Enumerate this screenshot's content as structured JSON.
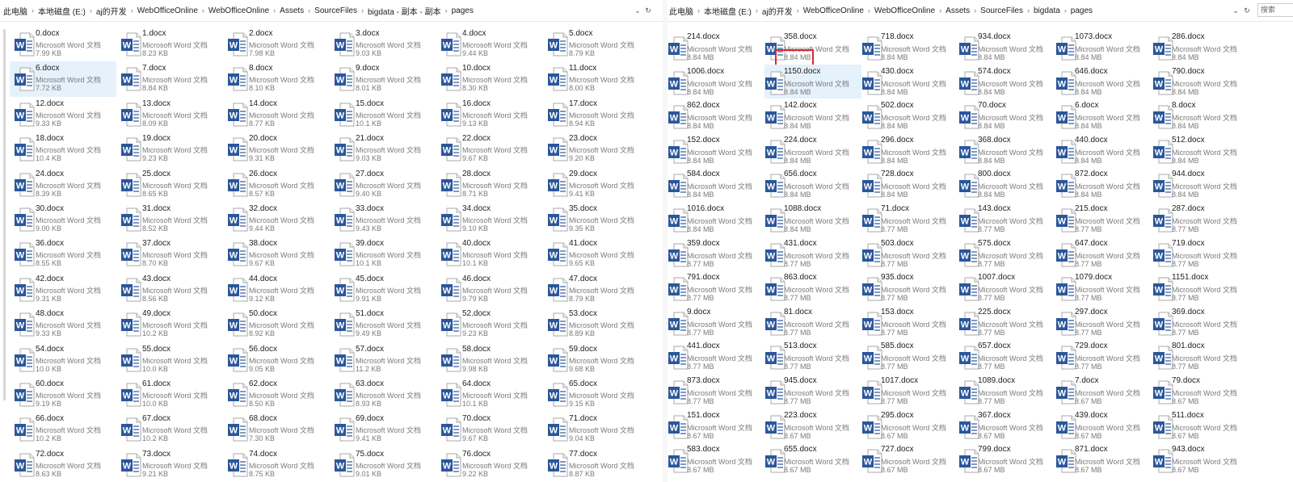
{
  "left_window": {
    "breadcrumb": [
      "此电脑",
      "本地磁盘 (E:)",
      "aj的开发",
      "WebOfficeOnline",
      "WebOfficeOnline",
      "Assets",
      "SourceFiles",
      "bigdata - 副本 - 副本",
      "pages"
    ],
    "files": [
      {
        "name": "0.docx",
        "type": "Microsoft Word 文档",
        "size": "7.99 KB"
      },
      {
        "name": "1.docx",
        "type": "Microsoft Word 文档",
        "size": "8.23 KB"
      },
      {
        "name": "2.docx",
        "type": "Microsoft Word 文档",
        "size": "7.98 KB"
      },
      {
        "name": "3.docx",
        "type": "Microsoft Word 文档",
        "size": "9.03 KB"
      },
      {
        "name": "4.docx",
        "type": "Microsoft Word 文档",
        "size": "9.44 KB"
      },
      {
        "name": "5.docx",
        "type": "Microsoft Word 文档",
        "size": "8.79 KB"
      },
      {
        "name": "6.docx",
        "type": "Microsoft Word 文档",
        "size": "7.72 KB",
        "selected": true
      },
      {
        "name": "7.docx",
        "type": "Microsoft Word 文档",
        "size": "8.84 KB"
      },
      {
        "name": "8.docx",
        "type": "Microsoft Word 文档",
        "size": "8.10 KB"
      },
      {
        "name": "9.docx",
        "type": "Microsoft Word 文档",
        "size": "8.01 KB"
      },
      {
        "name": "10.docx",
        "type": "Microsoft Word 文档",
        "size": "8.30 KB"
      },
      {
        "name": "11.docx",
        "type": "Microsoft Word 文档",
        "size": "8.00 KB"
      },
      {
        "name": "12.docx",
        "type": "Microsoft Word 文档",
        "size": "9.33 KB"
      },
      {
        "name": "13.docx",
        "type": "Microsoft Word 文档",
        "size": "8.09 KB"
      },
      {
        "name": "14.docx",
        "type": "Microsoft Word 文档",
        "size": "8.77 KB"
      },
      {
        "name": "15.docx",
        "type": "Microsoft Word 文档",
        "size": "10.1 KB"
      },
      {
        "name": "16.docx",
        "type": "Microsoft Word 文档",
        "size": "9.13 KB"
      },
      {
        "name": "17.docx",
        "type": "Microsoft Word 文档",
        "size": "8.94 KB"
      },
      {
        "name": "18.docx",
        "type": "Microsoft Word 文档",
        "size": "10.4 KB"
      },
      {
        "name": "19.docx",
        "type": "Microsoft Word 文档",
        "size": "9.23 KB"
      },
      {
        "name": "20.docx",
        "type": "Microsoft Word 文档",
        "size": "9.31 KB"
      },
      {
        "name": "21.docx",
        "type": "Microsoft Word 文档",
        "size": "9.03 KB"
      },
      {
        "name": "22.docx",
        "type": "Microsoft Word 文档",
        "size": "9.67 KB"
      },
      {
        "name": "23.docx",
        "type": "Microsoft Word 文档",
        "size": "9.20 KB"
      },
      {
        "name": "24.docx",
        "type": "Microsoft Word 文档",
        "size": "8.39 KB"
      },
      {
        "name": "25.docx",
        "type": "Microsoft Word 文档",
        "size": "8.65 KB"
      },
      {
        "name": "26.docx",
        "type": "Microsoft Word 文档",
        "size": "8.57 KB"
      },
      {
        "name": "27.docx",
        "type": "Microsoft Word 文档",
        "size": "9.40 KB"
      },
      {
        "name": "28.docx",
        "type": "Microsoft Word 文档",
        "size": "8.71 KB"
      },
      {
        "name": "29.docx",
        "type": "Microsoft Word 文档",
        "size": "9.41 KB"
      },
      {
        "name": "30.docx",
        "type": "Microsoft Word 文档",
        "size": "9.00 KB"
      },
      {
        "name": "31.docx",
        "type": "Microsoft Word 文档",
        "size": "8.52 KB"
      },
      {
        "name": "32.docx",
        "type": "Microsoft Word 文档",
        "size": "9.44 KB"
      },
      {
        "name": "33.docx",
        "type": "Microsoft Word 文档",
        "size": "9.43 KB"
      },
      {
        "name": "34.docx",
        "type": "Microsoft Word 文档",
        "size": "9.10 KB"
      },
      {
        "name": "35.docx",
        "type": "Microsoft Word 文档",
        "size": "9.35 KB"
      },
      {
        "name": "36.docx",
        "type": "Microsoft Word 文档",
        "size": "8.55 KB"
      },
      {
        "name": "37.docx",
        "type": "Microsoft Word 文档",
        "size": "8.70 KB"
      },
      {
        "name": "38.docx",
        "type": "Microsoft Word 文档",
        "size": "9.67 KB"
      },
      {
        "name": "39.docx",
        "type": "Microsoft Word 文档",
        "size": "10.1 KB"
      },
      {
        "name": "40.docx",
        "type": "Microsoft Word 文档",
        "size": "10.1 KB"
      },
      {
        "name": "41.docx",
        "type": "Microsoft Word 文档",
        "size": "9.65 KB"
      },
      {
        "name": "42.docx",
        "type": "Microsoft Word 文档",
        "size": "9.31 KB"
      },
      {
        "name": "43.docx",
        "type": "Microsoft Word 文档",
        "size": "8.56 KB"
      },
      {
        "name": "44.docx",
        "type": "Microsoft Word 文档",
        "size": "9.12 KB"
      },
      {
        "name": "45.docx",
        "type": "Microsoft Word 文档",
        "size": "9.91 KB"
      },
      {
        "name": "46.docx",
        "type": "Microsoft Word 文档",
        "size": "9.79 KB"
      },
      {
        "name": "47.docx",
        "type": "Microsoft Word 文档",
        "size": "8.79 KB"
      },
      {
        "name": "48.docx",
        "type": "Microsoft Word 文档",
        "size": "9.33 KB"
      },
      {
        "name": "49.docx",
        "type": "Microsoft Word 文档",
        "size": "10.2 KB"
      },
      {
        "name": "50.docx",
        "type": "Microsoft Word 文档",
        "size": "8.92 KB"
      },
      {
        "name": "51.docx",
        "type": "Microsoft Word 文档",
        "size": "9.49 KB"
      },
      {
        "name": "52.docx",
        "type": "Microsoft Word 文档",
        "size": "9.23 KB"
      },
      {
        "name": "53.docx",
        "type": "Microsoft Word 文档",
        "size": "8.89 KB"
      },
      {
        "name": "54.docx",
        "type": "Microsoft Word 文档",
        "size": "10.0 KB"
      },
      {
        "name": "55.docx",
        "type": "Microsoft Word 文档",
        "size": "10.0 KB"
      },
      {
        "name": "56.docx",
        "type": "Microsoft Word 文档",
        "size": "9.05 KB"
      },
      {
        "name": "57.docx",
        "type": "Microsoft Word 文档",
        "size": "11.2 KB"
      },
      {
        "name": "58.docx",
        "type": "Microsoft Word 文档",
        "size": "9.98 KB"
      },
      {
        "name": "59.docx",
        "type": "Microsoft Word 文档",
        "size": "9.68 KB"
      },
      {
        "name": "60.docx",
        "type": "Microsoft Word 文档",
        "size": "9.19 KB"
      },
      {
        "name": "61.docx",
        "type": "Microsoft Word 文档",
        "size": "10.0 KB"
      },
      {
        "name": "62.docx",
        "type": "Microsoft Word 文档",
        "size": "8.50 KB"
      },
      {
        "name": "63.docx",
        "type": "Microsoft Word 文档",
        "size": "8.93 KB"
      },
      {
        "name": "64.docx",
        "type": "Microsoft Word 文档",
        "size": "10.1 KB"
      },
      {
        "name": "65.docx",
        "type": "Microsoft Word 文档",
        "size": "9.15 KB"
      },
      {
        "name": "66.docx",
        "type": "Microsoft Word 文档",
        "size": "10.2 KB"
      },
      {
        "name": "67.docx",
        "type": "Microsoft Word 文档",
        "size": "10.2 KB"
      },
      {
        "name": "68.docx",
        "type": "Microsoft Word 文档",
        "size": "7.30 KB"
      },
      {
        "name": "69.docx",
        "type": "Microsoft Word 文档",
        "size": "9.41 KB"
      },
      {
        "name": "70.docx",
        "type": "Microsoft Word 文档",
        "size": "9.67 KB"
      },
      {
        "name": "71.docx",
        "type": "Microsoft Word 文档",
        "size": "9.04 KB"
      },
      {
        "name": "72.docx",
        "type": "Microsoft Word 文档",
        "size": "8.63 KB"
      },
      {
        "name": "73.docx",
        "type": "Microsoft Word 文档",
        "size": "9.21 KB"
      },
      {
        "name": "74.docx",
        "type": "Microsoft Word 文档",
        "size": "8.75 KB"
      },
      {
        "name": "75.docx",
        "type": "Microsoft Word 文档",
        "size": "9.01 KB"
      },
      {
        "name": "76.docx",
        "type": "Microsoft Word 文档",
        "size": "9.22 KB"
      },
      {
        "name": "77.docx",
        "type": "Microsoft Word 文档",
        "size": "8.87 KB"
      }
    ]
  },
  "right_window": {
    "breadcrumb": [
      "此电脑",
      "本地磁盘 (E:)",
      "aj的开发",
      "WebOfficeOnline",
      "WebOfficeOnline",
      "Assets",
      "SourceFiles",
      "bigdata",
      "pages"
    ],
    "search_placeholder": "搜索",
    "files": [
      {
        "name": "214.docx",
        "type": "Microsoft Word 文档",
        "size": "8.84 MB"
      },
      {
        "name": "358.docx",
        "type": "Microsoft Word 文档",
        "size": "8.84 MB",
        "highlighted": true
      },
      {
        "name": "718.docx",
        "type": "Microsoft Word 文档",
        "size": "8.84 MB"
      },
      {
        "name": "934.docx",
        "type": "Microsoft Word 文档",
        "size": "8.84 MB"
      },
      {
        "name": "1073.docx",
        "type": "Microsoft Word 文档",
        "size": "8.84 MB"
      },
      {
        "name": "286.docx",
        "type": "Microsoft Word 文档",
        "size": "8.84 MB"
      },
      {
        "name": "1006.docx",
        "type": "Microsoft Word 文档",
        "size": "8.84 MB"
      },
      {
        "name": "1150.docx",
        "type": "Microsoft Word 文档",
        "size": "8.84 MB",
        "selected": true
      },
      {
        "name": "430.docx",
        "type": "Microsoft Word 文档",
        "size": "8.84 MB"
      },
      {
        "name": "574.docx",
        "type": "Microsoft Word 文档",
        "size": "8.84 MB"
      },
      {
        "name": "646.docx",
        "type": "Microsoft Word 文档",
        "size": "8.84 MB"
      },
      {
        "name": "790.docx",
        "type": "Microsoft Word 文档",
        "size": "8.84 MB"
      },
      {
        "name": "862.docx",
        "type": "Microsoft Word 文档",
        "size": "8.84 MB"
      },
      {
        "name": "142.docx",
        "type": "Microsoft Word 文档",
        "size": "8.84 MB"
      },
      {
        "name": "502.docx",
        "type": "Microsoft Word 文档",
        "size": "8.84 MB"
      },
      {
        "name": "70.docx",
        "type": "Microsoft Word 文档",
        "size": "8.84 MB"
      },
      {
        "name": "6.docx",
        "type": "Microsoft Word 文档",
        "size": "8.84 MB"
      },
      {
        "name": "8.docx",
        "type": "Microsoft Word 文档",
        "size": "8.84 MB"
      },
      {
        "name": "152.docx",
        "type": "Microsoft Word 文档",
        "size": "8.84 MB"
      },
      {
        "name": "224.docx",
        "type": "Microsoft Word 文档",
        "size": "8.84 MB"
      },
      {
        "name": "296.docx",
        "type": "Microsoft Word 文档",
        "size": "8.84 MB"
      },
      {
        "name": "368.docx",
        "type": "Microsoft Word 文档",
        "size": "8.84 MB"
      },
      {
        "name": "440.docx",
        "type": "Microsoft Word 文档",
        "size": "8.84 MB"
      },
      {
        "name": "512.docx",
        "type": "Microsoft Word 文档",
        "size": "8.84 MB"
      },
      {
        "name": "584.docx",
        "type": "Microsoft Word 文档",
        "size": "8.84 MB"
      },
      {
        "name": "656.docx",
        "type": "Microsoft Word 文档",
        "size": "8.84 MB"
      },
      {
        "name": "728.docx",
        "type": "Microsoft Word 文档",
        "size": "8.84 MB"
      },
      {
        "name": "800.docx",
        "type": "Microsoft Word 文档",
        "size": "8.84 MB"
      },
      {
        "name": "872.docx",
        "type": "Microsoft Word 文档",
        "size": "8.84 MB"
      },
      {
        "name": "944.docx",
        "type": "Microsoft Word 文档",
        "size": "8.84 MB"
      },
      {
        "name": "1016.docx",
        "type": "Microsoft Word 文档",
        "size": "8.84 MB"
      },
      {
        "name": "1088.docx",
        "type": "Microsoft Word 文档",
        "size": "8.84 MB"
      },
      {
        "name": "71.docx",
        "type": "Microsoft Word 文档",
        "size": "8.77 MB"
      },
      {
        "name": "143.docx",
        "type": "Microsoft Word 文档",
        "size": "8.77 MB"
      },
      {
        "name": "215.docx",
        "type": "Microsoft Word 文档",
        "size": "8.77 MB"
      },
      {
        "name": "287.docx",
        "type": "Microsoft Word 文档",
        "size": "8.77 MB"
      },
      {
        "name": "359.docx",
        "type": "Microsoft Word 文档",
        "size": "8.77 MB"
      },
      {
        "name": "431.docx",
        "type": "Microsoft Word 文档",
        "size": "8.77 MB"
      },
      {
        "name": "503.docx",
        "type": "Microsoft Word 文档",
        "size": "8.77 MB"
      },
      {
        "name": "575.docx",
        "type": "Microsoft Word 文档",
        "size": "8.77 MB"
      },
      {
        "name": "647.docx",
        "type": "Microsoft Word 文档",
        "size": "8.77 MB"
      },
      {
        "name": "719.docx",
        "type": "Microsoft Word 文档",
        "size": "8.77 MB"
      },
      {
        "name": "791.docx",
        "type": "Microsoft Word 文档",
        "size": "8.77 MB"
      },
      {
        "name": "863.docx",
        "type": "Microsoft Word 文档",
        "size": "8.77 MB"
      },
      {
        "name": "935.docx",
        "type": "Microsoft Word 文档",
        "size": "8.77 MB"
      },
      {
        "name": "1007.docx",
        "type": "Microsoft Word 文档",
        "size": "8.77 MB"
      },
      {
        "name": "1079.docx",
        "type": "Microsoft Word 文档",
        "size": "8.77 MB"
      },
      {
        "name": "1151.docx",
        "type": "Microsoft Word 文档",
        "size": "8.77 MB"
      },
      {
        "name": "9.docx",
        "type": "Microsoft Word 文档",
        "size": "8.77 MB"
      },
      {
        "name": "81.docx",
        "type": "Microsoft Word 文档",
        "size": "8.77 MB"
      },
      {
        "name": "153.docx",
        "type": "Microsoft Word 文档",
        "size": "8.77 MB"
      },
      {
        "name": "225.docx",
        "type": "Microsoft Word 文档",
        "size": "8.77 MB"
      },
      {
        "name": "297.docx",
        "type": "Microsoft Word 文档",
        "size": "8.77 MB"
      },
      {
        "name": "369.docx",
        "type": "Microsoft Word 文档",
        "size": "8.77 MB"
      },
      {
        "name": "441.docx",
        "type": "Microsoft Word 文档",
        "size": "8.77 MB"
      },
      {
        "name": "513.docx",
        "type": "Microsoft Word 文档",
        "size": "8.77 MB"
      },
      {
        "name": "585.docx",
        "type": "Microsoft Word 文档",
        "size": "8.77 MB"
      },
      {
        "name": "657.docx",
        "type": "Microsoft Word 文档",
        "size": "8.77 MB"
      },
      {
        "name": "729.docx",
        "type": "Microsoft Word 文档",
        "size": "8.77 MB"
      },
      {
        "name": "801.docx",
        "type": "Microsoft Word 文档",
        "size": "8.77 MB"
      },
      {
        "name": "873.docx",
        "type": "Microsoft Word 文档",
        "size": "8.77 MB"
      },
      {
        "name": "945.docx",
        "type": "Microsoft Word 文档",
        "size": "8.77 MB"
      },
      {
        "name": "1017.docx",
        "type": "Microsoft Word 文档",
        "size": "8.77 MB"
      },
      {
        "name": "1089.docx",
        "type": "Microsoft Word 文档",
        "size": "8.77 MB"
      },
      {
        "name": "7.docx",
        "type": "Microsoft Word 文档",
        "size": "8.67 MB"
      },
      {
        "name": "79.docx",
        "type": "Microsoft Word 文档",
        "size": "8.67 MB"
      },
      {
        "name": "151.docx",
        "type": "Microsoft Word 文档",
        "size": "8.67 MB"
      },
      {
        "name": "223.docx",
        "type": "Microsoft Word 文档",
        "size": "8.67 MB"
      },
      {
        "name": "295.docx",
        "type": "Microsoft Word 文档",
        "size": "8.67 MB"
      },
      {
        "name": "367.docx",
        "type": "Microsoft Word 文档",
        "size": "8.67 MB"
      },
      {
        "name": "439.docx",
        "type": "Microsoft Word 文档",
        "size": "8.67 MB"
      },
      {
        "name": "511.docx",
        "type": "Microsoft Word 文档",
        "size": "8.67 MB"
      },
      {
        "name": "583.docx",
        "type": "Microsoft Word 文档",
        "size": "8.67 MB"
      },
      {
        "name": "655.docx",
        "type": "Microsoft Word 文档",
        "size": "8.67 MB"
      },
      {
        "name": "727.docx",
        "type": "Microsoft Word 文档",
        "size": "8.67 MB"
      },
      {
        "name": "799.docx",
        "type": "Microsoft Word 文档",
        "size": "8.67 MB"
      },
      {
        "name": "871.docx",
        "type": "Microsoft Word 文档",
        "size": "8.67 MB"
      },
      {
        "name": "943.docx",
        "type": "Microsoft Word 文档",
        "size": "8.67 MB"
      }
    ]
  },
  "colors": {
    "word_blue": "#2b579a",
    "selection_bg": "#e5f1fb",
    "highlight_red": "#e02828"
  },
  "icons": {
    "file_icon": "word-document-icon",
    "dropdown": "chevron-down-icon",
    "refresh": "refresh-icon"
  }
}
